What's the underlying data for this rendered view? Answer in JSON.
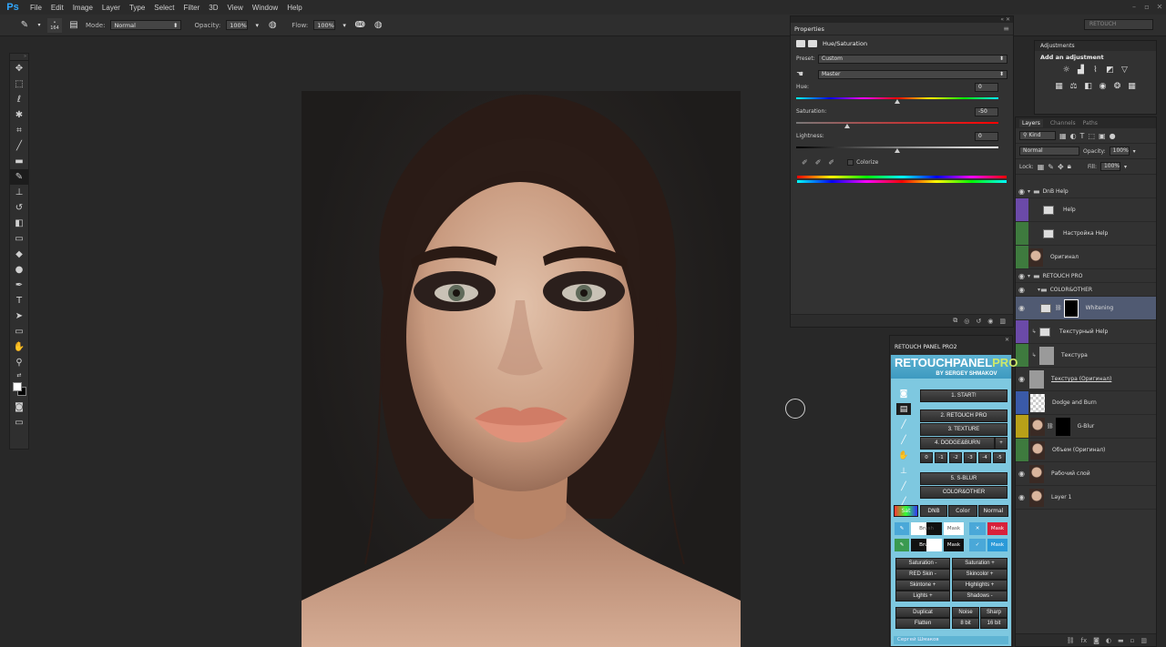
{
  "app": {
    "logo": "Ps",
    "menu": [
      "File",
      "Edit",
      "Image",
      "Layer",
      "Type",
      "Select",
      "Filter",
      "3D",
      "View",
      "Window",
      "Help"
    ],
    "workspace": "RETOUCH"
  },
  "options": {
    "brush_size": "164",
    "mode_label": "Mode:",
    "mode_value": "Normal",
    "opacity_label": "Opacity:",
    "opacity_value": "100%",
    "flow_label": "Flow:",
    "flow_value": "100%"
  },
  "tools": [
    "move",
    "marquee",
    "lasso",
    "quick-select",
    "crop",
    "eyedropper",
    "healing-brush",
    "brush",
    "clone-stamp",
    "history-brush",
    "eraser",
    "gradient",
    "blur",
    "dodge",
    "pen",
    "type",
    "path-select",
    "shape",
    "hand",
    "zoom"
  ],
  "properties": {
    "tab": "Properties",
    "type": "Hue/Saturation",
    "preset_label": "Preset:",
    "preset_value": "Custom",
    "channel_value": "Master",
    "hue_label": "Hue:",
    "hue_value": "0",
    "hue_position": 0.5,
    "saturation_label": "Saturation:",
    "saturation_value": "-50",
    "saturation_position": 0.25,
    "lightness_label": "Lightness:",
    "lightness_value": "0",
    "lightness_position": 0.5,
    "colorize_label": "Colorize"
  },
  "adjustments": {
    "tab": "Adjustments",
    "heading": "Add an adjustment"
  },
  "layers": {
    "tabs": [
      "Layers",
      "Channels",
      "Paths"
    ],
    "filter_kind": "Kind",
    "blend_mode": "Normal",
    "opacity_label": "Opacity:",
    "opacity_value": "100%",
    "lock_label": "Lock:",
    "fill_label": "Fill:",
    "fill_value": "100%",
    "rows": [
      {
        "name": "DnB Help",
        "kind": "group",
        "color": "#3c3c3c"
      },
      {
        "name": "Help",
        "kind": "adjustment",
        "color": "#6b4aa8"
      },
      {
        "name": "Настройка Help",
        "kind": "adjustment",
        "color": "#3e7a3e"
      },
      {
        "name": "Оригинал",
        "kind": "face",
        "color": "#3e7a3e"
      },
      {
        "name": "RETOUCH PRO",
        "kind": "group",
        "color": "#3c3c3c"
      },
      {
        "name": "COLOR&OTHER",
        "kind": "subgroup",
        "color": "#3c3c3c"
      },
      {
        "name": "Whitening",
        "kind": "mask",
        "color": "#505a72"
      },
      {
        "name": "Текстурный Help",
        "kind": "adjustment",
        "color": "#6b4aa8"
      },
      {
        "name": "Текстура",
        "kind": "gray",
        "color": "#3e7a3e"
      },
      {
        "name": "Текстура (Оригинал)",
        "kind": "gray",
        "color": "#3c3c3c"
      },
      {
        "name": "Dodge and Burn",
        "kind": "checker",
        "color": "#3a5aa8"
      },
      {
        "name": "G-Blur",
        "kind": "facemask",
        "color": "#b8a018"
      },
      {
        "name": "Объем (Оригинал)",
        "kind": "face",
        "color": "#3e7a3e"
      },
      {
        "name": "Рабочий слой",
        "kind": "face",
        "color": "#3c3c3c"
      },
      {
        "name": "Layer 1",
        "kind": "face",
        "color": "#3c3c3c"
      }
    ]
  },
  "retouch_panel": {
    "title": "RETOUCH PANEL PRO2",
    "logo_main": "RETOUCHPANEL",
    "logo_pro": "PRO",
    "logo_by": "BY SERGEY SHMAKOV",
    "start": "1. START!",
    "retouch_pro": "2. RETOUCH PRO",
    "texture": "3. TEXTURE",
    "dodge_burn": "4. DODGE&BURN",
    "plus": "+",
    "levels": [
      "0",
      "-1",
      "-2",
      "-3",
      "-4",
      "-5"
    ],
    "sblur": "5. S-BLUR",
    "color_other": "COLOR&OTHER",
    "tabs": [
      "Sat",
      "DNB",
      "Color",
      "Normal"
    ],
    "brush_label": "Brush",
    "mask_label": "Mask",
    "adjust_left": [
      "Saturation -",
      "RED Skin -",
      "Skintone +",
      "Lights +"
    ],
    "adjust_right": [
      "Saturation +",
      "Skincolor +",
      "Highlights +",
      "Shadows -"
    ],
    "bottom": [
      "Duplicat",
      "Flatten",
      "Noise",
      "8 bit",
      "Sharp",
      "16 bit"
    ],
    "author": "Сергей Шмаков"
  }
}
